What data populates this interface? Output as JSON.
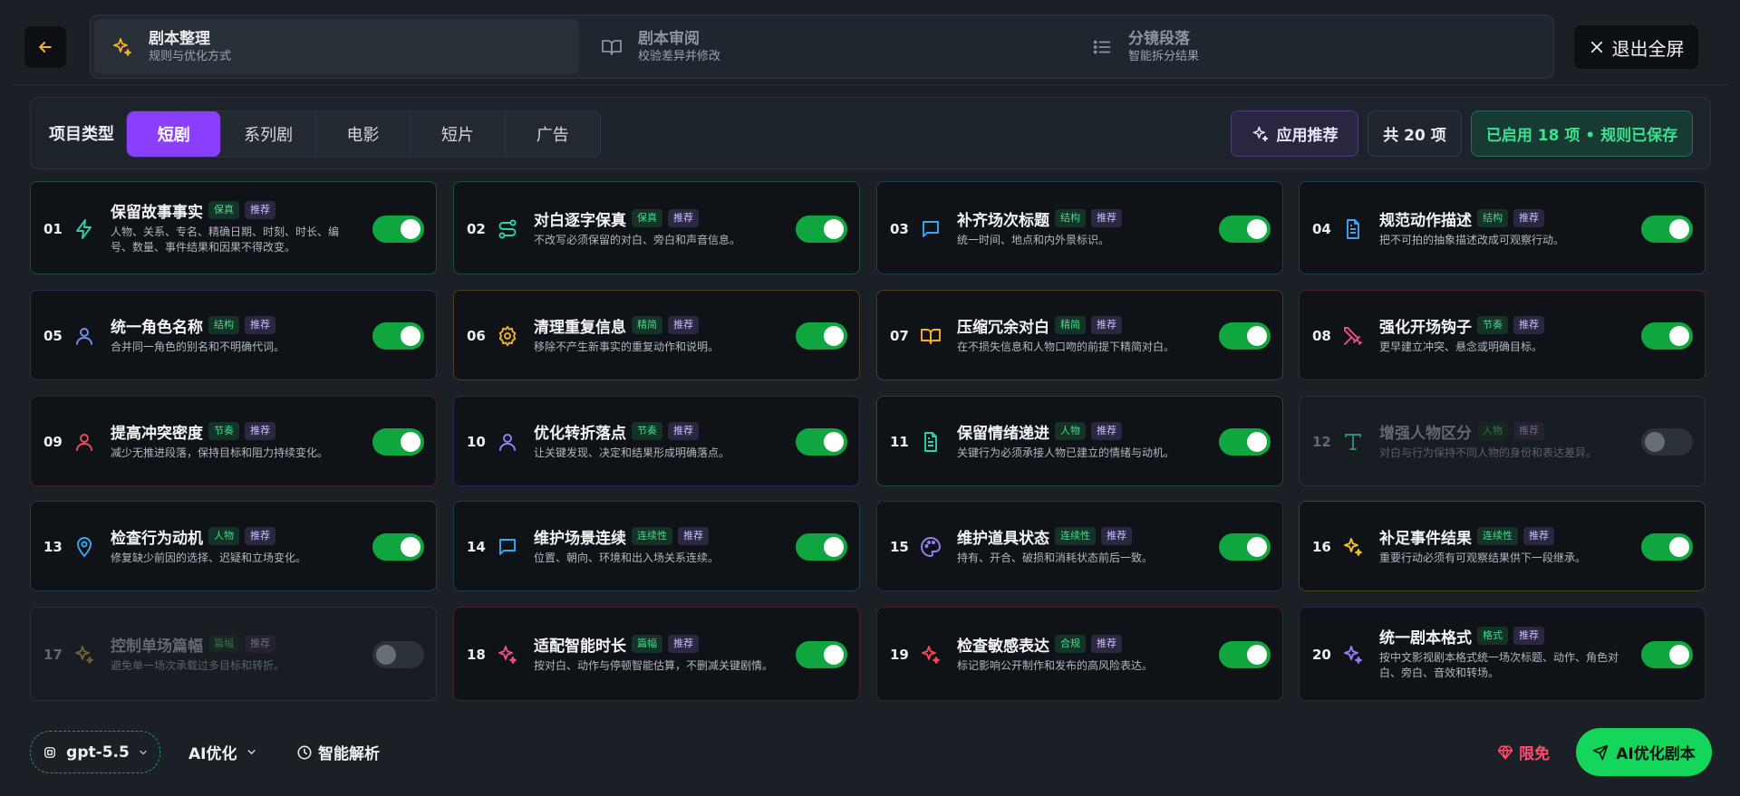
{
  "steps": [
    {
      "title": "剧本整理",
      "subtitle": "规则与优化方式",
      "icon": "sparkles-icon",
      "active": true
    },
    {
      "title": "剧本审阅",
      "subtitle": "校验差异并修改",
      "icon": "book-open-icon",
      "active": false
    },
    {
      "title": "分镜段落",
      "subtitle": "智能拆分结果",
      "icon": "list-icon",
      "active": false
    }
  ],
  "header": {
    "exit_label": "退出全屏"
  },
  "filter": {
    "type_label": "项目类型",
    "types": [
      "短剧",
      "系列剧",
      "电影",
      "短片",
      "广告"
    ],
    "selected": "短剧",
    "apply_label": "应用推荐",
    "count_label": "共 20 项",
    "status_label": "已启用 18 项 • 规则已保存"
  },
  "colors": {
    "accent_purple": "#8a3fff",
    "toggle_on": "#0fa640",
    "primary_green": "#13d65a",
    "danger_pink": "#ff4d6d"
  },
  "rules": [
    {
      "num": "01",
      "title": "保留故事事实",
      "category": "保真",
      "recommend": "推荐",
      "desc": "人物、关系、专名、精确日期、时刻、时长、编号、数量、事件结果和因果不得改变。",
      "icon": "zap-icon",
      "enabled": true
    },
    {
      "num": "02",
      "title": "对白逐字保真",
      "category": "保真",
      "recommend": "推荐",
      "desc": "不改写必须保留的对白、旁白和声音信息。",
      "icon": "route-icon",
      "enabled": true
    },
    {
      "num": "03",
      "title": "补齐场次标题",
      "category": "结构",
      "recommend": "推荐",
      "desc": "统一时间、地点和内外景标识。",
      "icon": "message-icon",
      "enabled": true
    },
    {
      "num": "04",
      "title": "规范动作描述",
      "category": "结构",
      "recommend": "推荐",
      "desc": "把不可拍的抽象描述改成可观察行动。",
      "icon": "file-text-icon",
      "enabled": true
    },
    {
      "num": "05",
      "title": "统一角色名称",
      "category": "结构",
      "recommend": "推荐",
      "desc": "合并同一角色的别名和不明确代词。",
      "icon": "user-icon",
      "enabled": true
    },
    {
      "num": "06",
      "title": "清理重复信息",
      "category": "精简",
      "recommend": "推荐",
      "desc": "移除不产生新事实的重复动作和说明。",
      "icon": "gear-icon",
      "enabled": true
    },
    {
      "num": "07",
      "title": "压缩冗余对白",
      "category": "精简",
      "recommend": "推荐",
      "desc": "在不损失信息和人物口吻的前提下精简对白。",
      "icon": "book-icon",
      "enabled": true
    },
    {
      "num": "08",
      "title": "强化开场钩子",
      "category": "节奏",
      "recommend": "推荐",
      "desc": "更早建立冲突、悬念或明确目标。",
      "icon": "swords-icon",
      "enabled": true
    },
    {
      "num": "09",
      "title": "提高冲突密度",
      "category": "节奏",
      "recommend": "推荐",
      "desc": "减少无推进段落，保持目标和阻力持续变化。",
      "icon": "user-icon",
      "enabled": true
    },
    {
      "num": "10",
      "title": "优化转折落点",
      "category": "节奏",
      "recommend": "推荐",
      "desc": "让关键发现、决定和结果形成明确落点。",
      "icon": "user-icon",
      "enabled": true
    },
    {
      "num": "11",
      "title": "保留情绪递进",
      "category": "人物",
      "recommend": "推荐",
      "desc": "关键行为必须承接人物已建立的情绪与动机。",
      "icon": "file-text-icon",
      "enabled": true
    },
    {
      "num": "12",
      "title": "增强人物区分",
      "category": "人物",
      "recommend": "推荐",
      "desc": "对白与行为保持不同人物的身份和表达差异。",
      "icon": "type-icon",
      "enabled": false
    },
    {
      "num": "13",
      "title": "检查行为动机",
      "category": "人物",
      "recommend": "推荐",
      "desc": "修复缺少前因的选择、迟疑和立场变化。",
      "icon": "map-pin-icon",
      "enabled": true
    },
    {
      "num": "14",
      "title": "维护场景连续",
      "category": "连续性",
      "recommend": "推荐",
      "desc": "位置、朝向、环境和出入场关系连续。",
      "icon": "message-icon",
      "enabled": true
    },
    {
      "num": "15",
      "title": "维护道具状态",
      "category": "连续性",
      "recommend": "推荐",
      "desc": "持有、开合、破损和消耗状态前后一致。",
      "icon": "palette-icon",
      "enabled": true
    },
    {
      "num": "16",
      "title": "补足事件结果",
      "category": "连续性",
      "recommend": "推荐",
      "desc": "重要行动必须有可观察结果供下一段继承。",
      "icon": "sparkles-icon",
      "enabled": true
    },
    {
      "num": "17",
      "title": "控制单场篇幅",
      "category": "篇幅",
      "recommend": "推荐",
      "desc": "避免单一场次承载过多目标和转折。",
      "icon": "sparkles-icon",
      "enabled": false
    },
    {
      "num": "18",
      "title": "适配智能时长",
      "category": "篇幅",
      "recommend": "推荐",
      "desc": "按对白、动作与停顿智能估算，不删减关键剧情。",
      "icon": "sparkles-icon",
      "enabled": true
    },
    {
      "num": "19",
      "title": "检查敏感表达",
      "category": "合规",
      "recommend": "推荐",
      "desc": "标记影响公开制作和发布的高风险表达。",
      "icon": "sparkles-icon",
      "enabled": true
    },
    {
      "num": "20",
      "title": "统一剧本格式",
      "category": "格式",
      "recommend": "推荐",
      "desc": "按中文影视剧本格式统一场次标题、动作、角色对白、旁白、音效和转场。",
      "icon": "sparkles-icon",
      "enabled": true
    }
  ],
  "footer": {
    "model": "gpt-5.5",
    "mode": "AI优化",
    "parse_label": "智能解析",
    "free_label": "限免",
    "run_label": "AI优化剧本"
  }
}
